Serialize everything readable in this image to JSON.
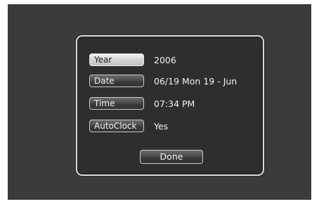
{
  "settings": {
    "rows": [
      {
        "label": "Year",
        "value": "2006"
      },
      {
        "label": "Date",
        "value": "06/19 Mon 19 - Jun"
      },
      {
        "label": "Time",
        "value": "07:34 PM"
      },
      {
        "label": "AutoClock",
        "value": "Yes"
      }
    ],
    "selected_row": "Year"
  },
  "done_label": "Done"
}
